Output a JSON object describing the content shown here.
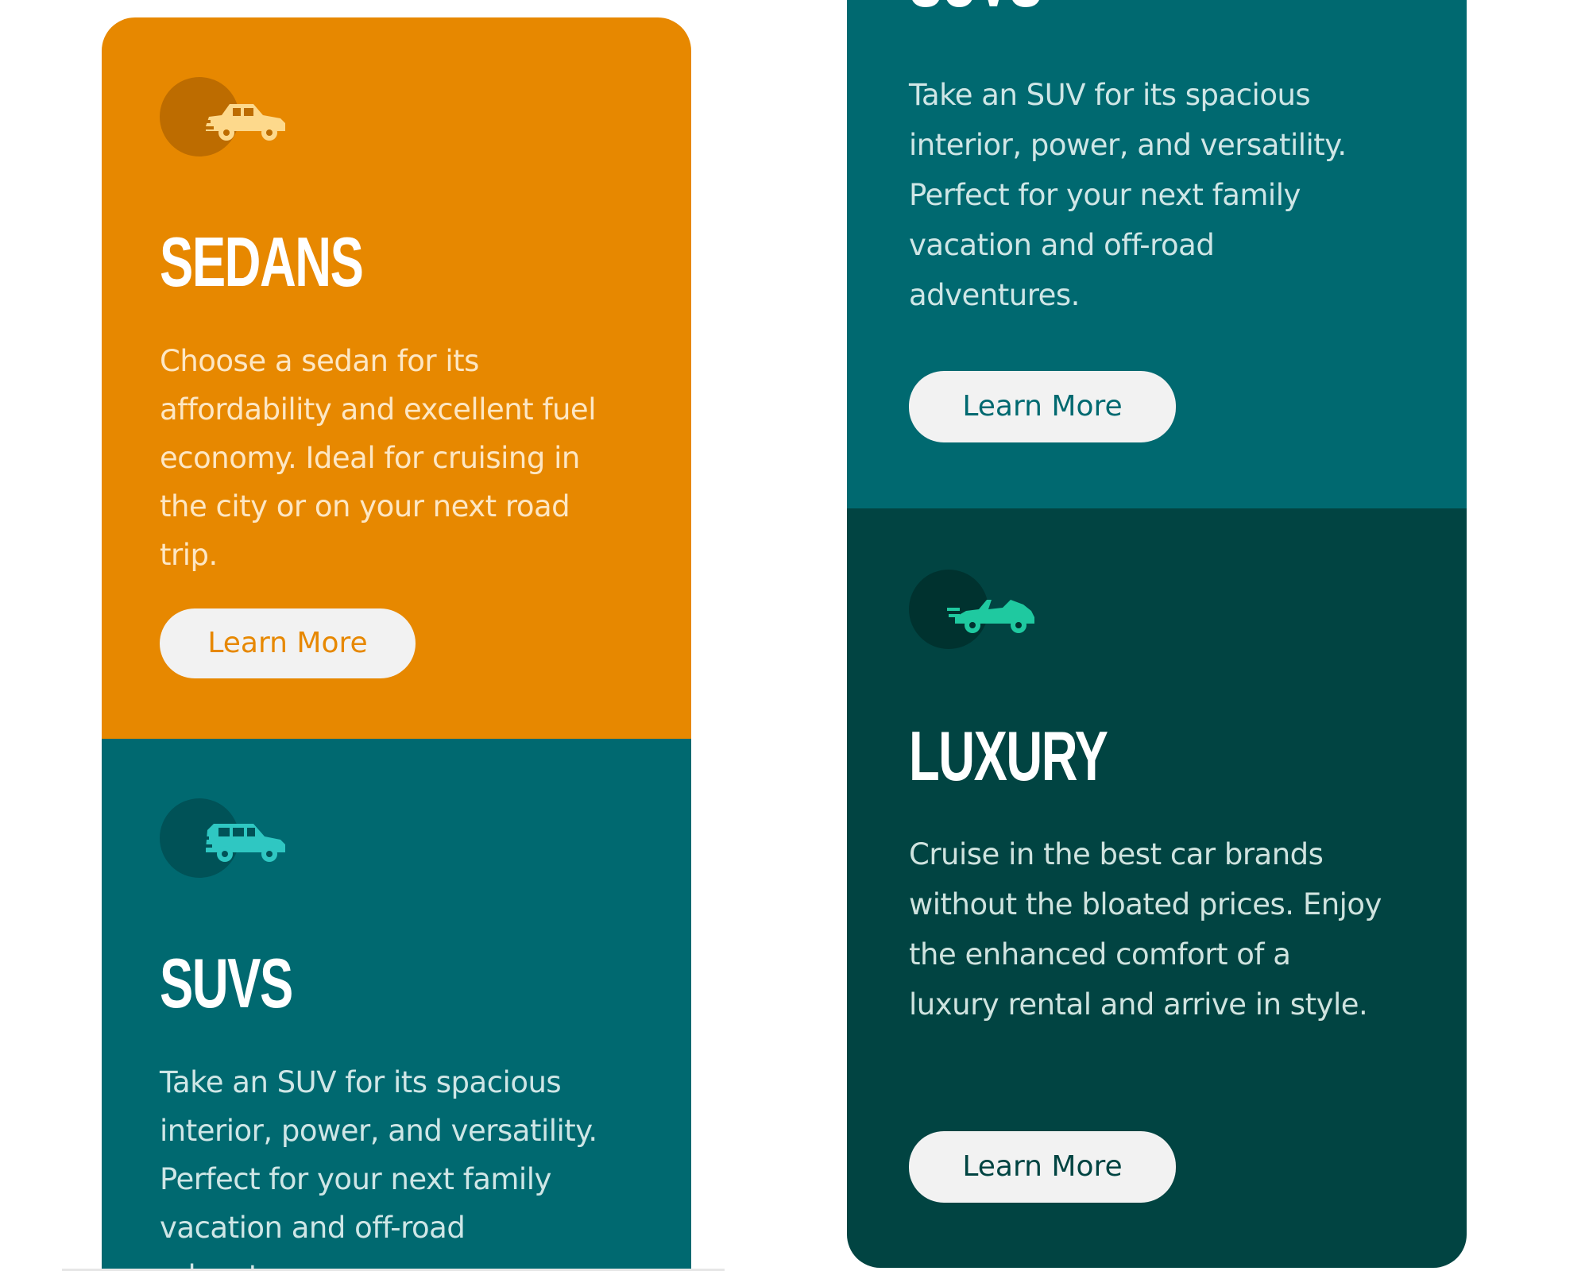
{
  "colors": {
    "sedan_bg": "#e78800",
    "suv_bg": "#006970",
    "luxury_bg": "#014442",
    "button_bg": "#f2f2f2"
  },
  "left_column": {
    "sedans": {
      "icon": "sedan-car-icon",
      "heading": "SEDANS",
      "description": "Choose a sedan for its affordability and excellent fuel economy. Ideal for cruising in the city or on your next road trip.",
      "button_label": "Learn More"
    },
    "suvs": {
      "icon": "suv-car-icon",
      "heading": "SUVS",
      "description": "Take an SUV for its spacious interior, power, and versatility. Perfect for your next family vacation and off-road adventures."
    }
  },
  "right_column": {
    "suvs": {
      "heading": "SUVS",
      "description": "Take an SUV for its spacious interior, power, and versatility. Perfect for your next family vacation and off-road adventures.",
      "button_label": "Learn More"
    },
    "luxury": {
      "icon": "luxury-convertible-icon",
      "heading": "LUXURY",
      "description": "Cruise in the best car brands without the bloated prices. Enjoy the enhanced comfort of a luxury rental and arrive in style.",
      "button_label": "Learn More"
    }
  }
}
